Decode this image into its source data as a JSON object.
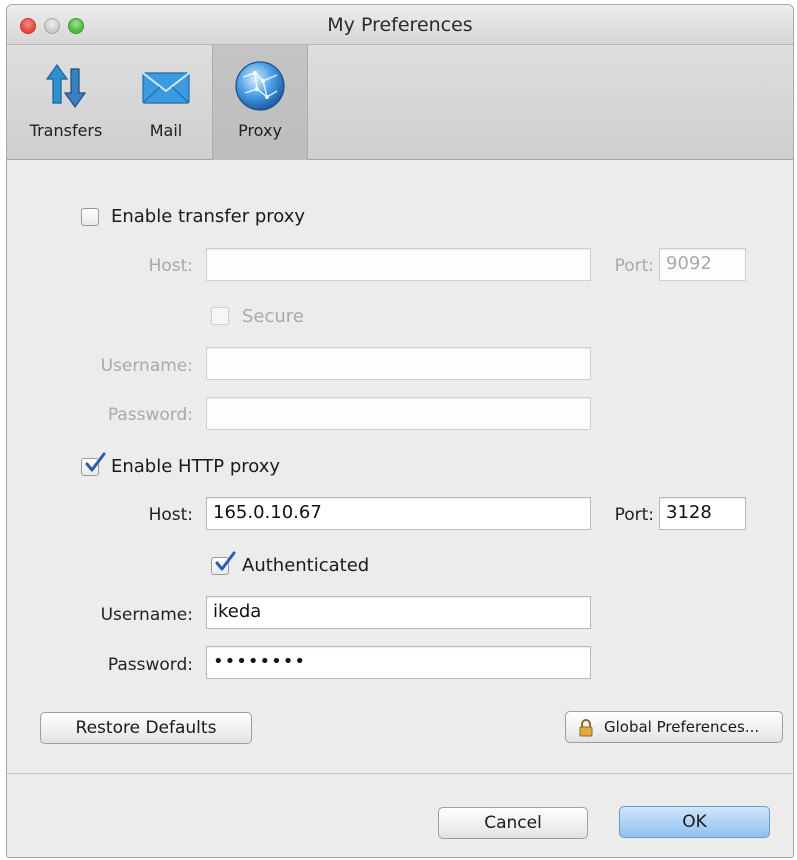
{
  "window": {
    "title": "My Preferences"
  },
  "toolbar": {
    "tabs": [
      {
        "label": "Transfers",
        "icon": "transfers-arrows-icon"
      },
      {
        "label": "Mail",
        "icon": "mail-envelope-icon"
      },
      {
        "label": "Proxy",
        "icon": "proxy-globe-icon",
        "selected": true
      }
    ]
  },
  "transfer_proxy": {
    "enable_label": "Enable transfer proxy",
    "enabled": false,
    "host_label": "Host:",
    "host_value": "",
    "port_label": "Port:",
    "port_value": "9092",
    "secure_label": "Secure",
    "secure_checked": false,
    "username_label": "Username:",
    "username_value": "",
    "password_label": "Password:",
    "password_value": ""
  },
  "http_proxy": {
    "enable_label": "Enable HTTP proxy",
    "enabled": true,
    "host_label": "Host:",
    "host_value": "165.0.10.67",
    "port_label": "Port:",
    "port_value": "3128",
    "authenticated_label": "Authenticated",
    "authenticated_checked": true,
    "username_label": "Username:",
    "username_value": "ikeda",
    "password_label": "Password:",
    "password_value": "••••••••"
  },
  "buttons": {
    "restore_defaults": "Restore Defaults",
    "global_preferences": "Global Preferences...",
    "cancel": "Cancel",
    "ok": "OK"
  },
  "colors": {
    "ok_button": "#8fc1f0",
    "checkbox_tick": "#2a5fb0"
  }
}
